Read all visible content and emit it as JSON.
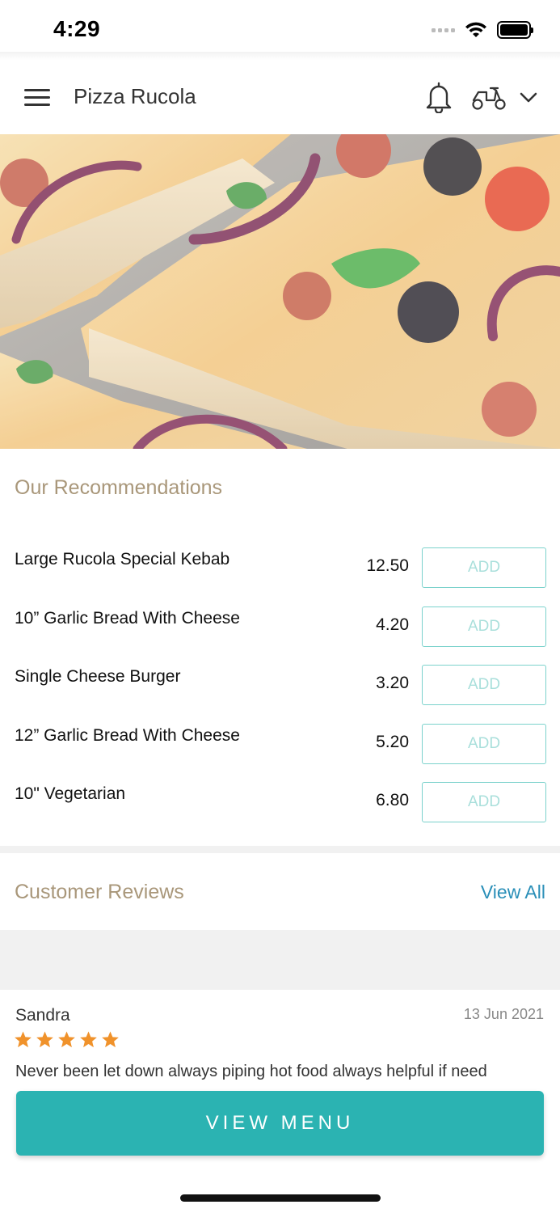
{
  "status_bar": {
    "time": "4:29"
  },
  "header": {
    "title": "Pizza Rucola",
    "icons": [
      "menu-icon",
      "bell-icon",
      "scooter-icon",
      "chevron-down-icon"
    ]
  },
  "hero": {
    "icon": "pizza-photo"
  },
  "recommendations": {
    "title": "Our Recommendations",
    "add_label": "ADD",
    "items": [
      {
        "name": "Large Rucola Special Kebab",
        "price": "12.50"
      },
      {
        "name": "10” Garlic Bread With Cheese",
        "price": "4.20"
      },
      {
        "name": "Single Cheese Burger",
        "price": "3.20"
      },
      {
        "name": "12” Garlic Bread With Cheese",
        "price": "5.20"
      },
      {
        "name": "10\" Vegetarian",
        "price": "6.80"
      }
    ]
  },
  "reviews": {
    "title": "Customer Reviews",
    "view_all": "View All",
    "items": [
      {
        "author": "Sandra",
        "date": "13 Jun 2021",
        "rating": 5,
        "text": "Never been let down always piping hot food always helpful if need"
      }
    ]
  },
  "cta": {
    "label": "VIEW MENU"
  },
  "colors": {
    "accent": "#2bb3b2",
    "section_title": "#a9977a",
    "link": "#2a8fb8",
    "star": "#f0922b",
    "add_border": "#7bd2cc"
  }
}
